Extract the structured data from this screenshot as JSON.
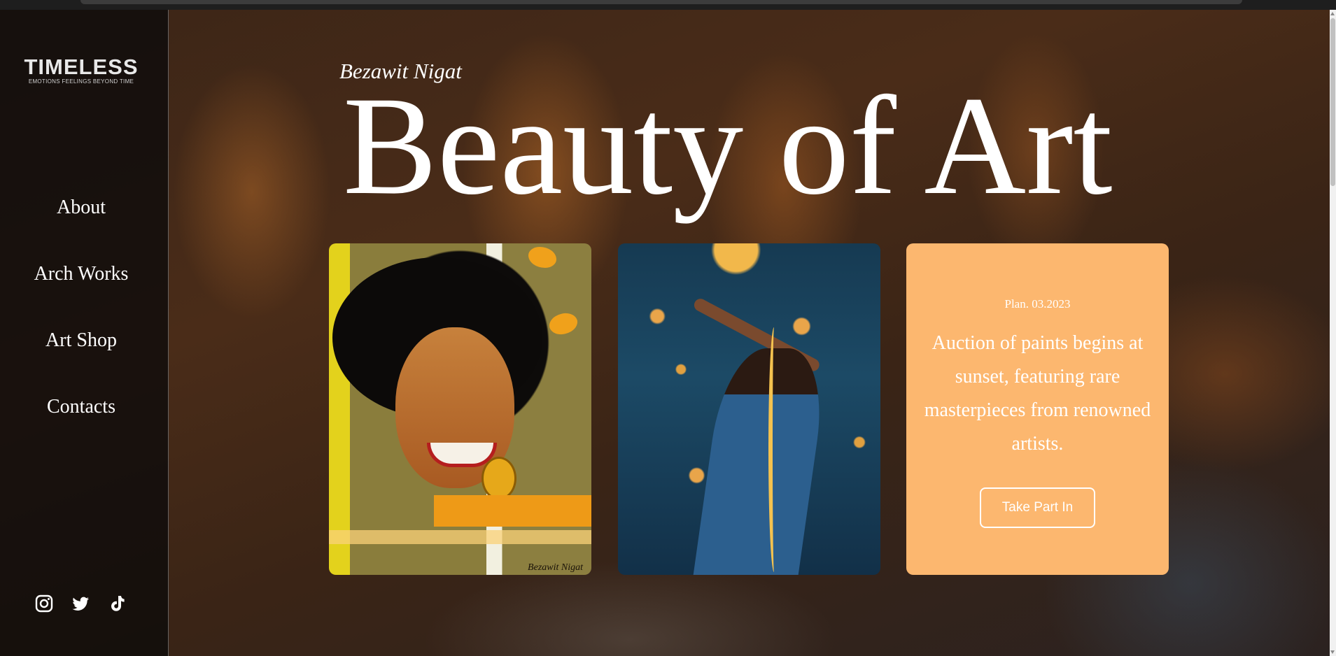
{
  "sidebar": {
    "logo": {
      "word": "TIMELESS",
      "tagline": "EMOTIONS FEELINGS BEYOND TIME"
    },
    "nav": [
      {
        "label": "About"
      },
      {
        "label": "Arch Works"
      },
      {
        "label": "Art Shop"
      },
      {
        "label": "Contacts"
      }
    ],
    "socials": [
      "instagram-icon",
      "twitter-icon",
      "tiktok-icon"
    ]
  },
  "hero": {
    "artist": "Bezawit Nigat",
    "title": "Beauty of Art"
  },
  "cards": {
    "artwork_1": {
      "signature": "Bezawit Nigat"
    },
    "auction": {
      "date": "Plan. 03.2023",
      "description": "Auction of paints begins at sunset, featuring rare masterpieces from renowned artists.",
      "button": "Take Part In"
    }
  },
  "colors": {
    "auction_card": "#fcb76f",
    "sidebar_bg": "#0c0a0a",
    "text": "#ffffff"
  }
}
